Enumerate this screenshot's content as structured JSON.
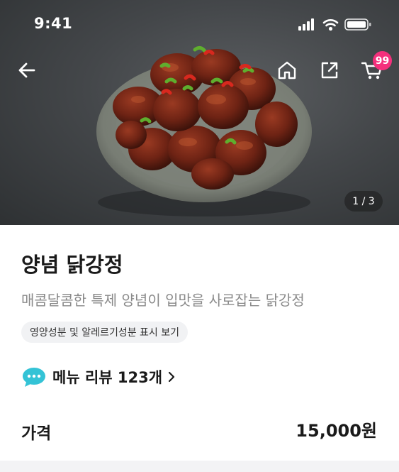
{
  "status_bar": {
    "time": "9:41"
  },
  "hero": {
    "page_counter": "1 / 3"
  },
  "header": {
    "back_icon": "arrow-left-icon",
    "home_icon": "home-icon",
    "share_icon": "share-icon",
    "cart_icon": "cart-icon",
    "cart_badge": "99"
  },
  "product": {
    "title": "양념 닭강정",
    "description": "매콤달콤한 특제 양념이 입맛을 사로잡는 닭강정",
    "nutrition_link": "영양성분 및 알레르기성분 표시 보기"
  },
  "reviews": {
    "label": "메뉴 리뷰 123개",
    "icon": "chat-bubble-icon"
  },
  "price": {
    "label": "가격",
    "value": "15,000원"
  },
  "colors": {
    "badge": "#f4307c",
    "review_icon": "#34c3d6",
    "chip_bg": "#f1f2f4"
  }
}
